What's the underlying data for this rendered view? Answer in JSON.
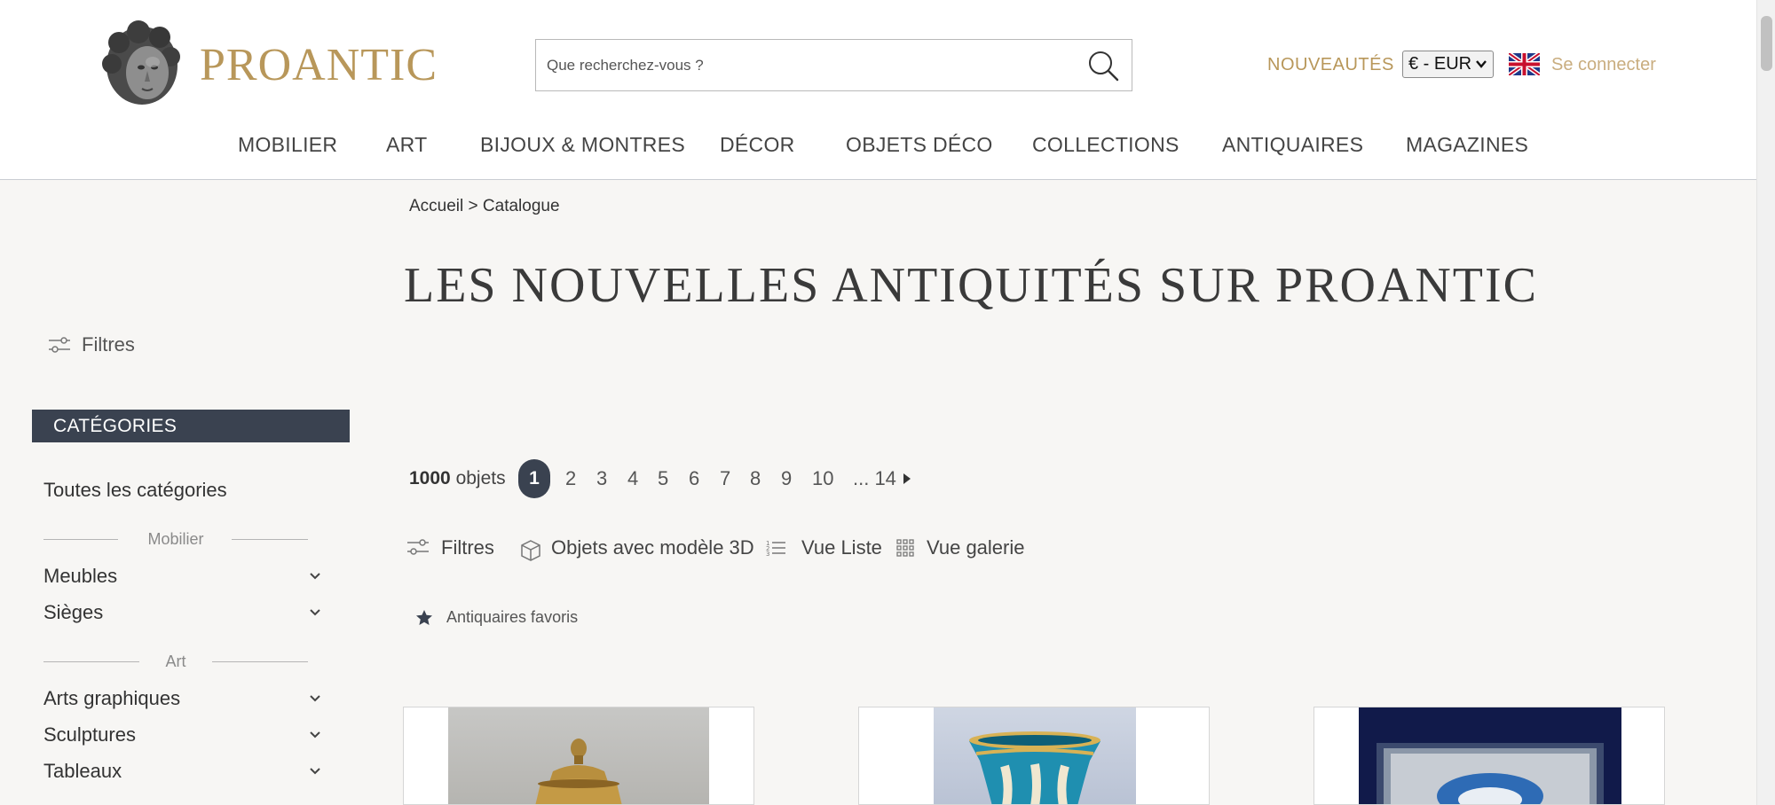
{
  "header": {
    "logo_text": "PROANTIC",
    "search_placeholder": "Que recherchez-vous ?",
    "nouveautes": "NOUVEAUTÉS",
    "currency": "€ - EUR",
    "login": "Se connecter"
  },
  "nav": [
    "MOBILIER",
    "ART",
    "BIJOUX & MONTRES",
    "DÉCOR",
    "OBJETS DÉCO",
    "COLLECTIONS",
    "ANTIQUAIRES",
    "MAGAZINES"
  ],
  "sidebar": {
    "filters_label": "Filtres",
    "categories_heading": "CATÉGORIES",
    "all_categories": "Toutes les catégories",
    "group_mobilier": "Mobilier",
    "mobilier_items": [
      "Meubles",
      "Sièges"
    ],
    "group_art": "Art",
    "art_items": [
      "Arts graphiques",
      "Sculptures",
      "Tableaux"
    ]
  },
  "breadcrumb": "Accueil > Catalogue",
  "page_title": "LES NOUVELLES ANTIQUITÉS SUR PROANTIC",
  "pagination": {
    "count_number": "1000",
    "count_label": "objets",
    "current": "1",
    "pages": [
      "2",
      "3",
      "4",
      "5",
      "6",
      "7",
      "8",
      "9",
      "10"
    ],
    "ellipsis_last": "... 14"
  },
  "toolbar": {
    "filters": "Filtres",
    "objects_3d": "Objets avec modèle 3D",
    "list_view": "Vue Liste",
    "gallery_view": "Vue galerie"
  },
  "favorite_dealers": "Antiquaires favoris",
  "colors": {
    "gold": "#b8975a",
    "dark_slate": "#3a4250",
    "background": "#f7f6f4"
  }
}
